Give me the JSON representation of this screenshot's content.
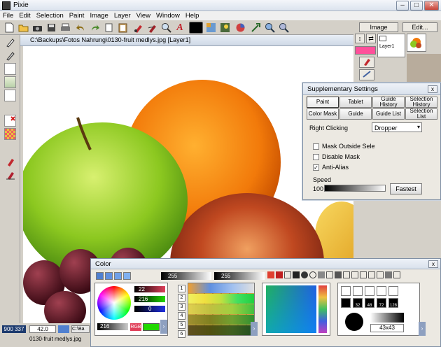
{
  "window": {
    "title": "Pixie",
    "minimize_glyph": "–",
    "maximize_glyph": "□",
    "close_glyph": "✕"
  },
  "menu": [
    "File",
    "Edit",
    "Selection",
    "Paint",
    "Image",
    "Layer",
    "View",
    "Window",
    "Help"
  ],
  "toolbar": {
    "icons": [
      "new-icon",
      "open-folder-icon",
      "camera-icon",
      "save-icon",
      "print-icon",
      "undo-icon",
      "redo-icon",
      "cut-icon",
      "paste-icon",
      "brush-icon",
      "smudge-icon",
      "zoom-icon",
      "text-icon",
      "color-swatch-icon",
      "pattern-icon",
      "effects-icon",
      "select-icon",
      "zoom-in-icon",
      "zoom-out-icon"
    ],
    "text_glyph": "A"
  },
  "document": {
    "title": "C:\\Backups\\Fotos Nahrung\\0130-fruit medlys.jpg [Layer1]"
  },
  "layers": {
    "image_button": "Image",
    "edit_button": "Edit...",
    "layer_name": "Layer1"
  },
  "supplementary": {
    "title": "Supplementary Settings",
    "tabs_row1": [
      "Paint",
      "Tablet",
      "Guide History",
      "Selection History"
    ],
    "tabs_row2": [
      "Color Mask",
      "Guide",
      "Guide List",
      "Selection List"
    ],
    "right_clicking_label": "Right Clicking",
    "right_clicking_value": "Dropper",
    "checkboxes": [
      {
        "label": "Mask Outside Sele",
        "checked": false
      },
      {
        "label": "Disable Mask",
        "checked": false
      },
      {
        "label": "Anti-Alias",
        "checked": true
      }
    ],
    "speed_label": "Speed",
    "speed_value": "100",
    "fastest_button": "Fastest",
    "close_glyph": "x"
  },
  "color": {
    "title": "Color",
    "top_value_1": "255",
    "top_value_2": "255",
    "rgb_values": [
      "22",
      "216",
      "0"
    ],
    "alpha_value": "216",
    "rgb_label": "RGB",
    "palette_tabs": [
      "1",
      "2",
      "3",
      "4",
      "5",
      "6"
    ],
    "brush_sizes": [
      "32",
      "48",
      "72",
      "128"
    ],
    "brush_dimension": "43x43",
    "close_glyph": "x"
  },
  "status": {
    "coords": "900 337",
    "zoom": "42.0",
    "filename": "0130-fruit medlys.jpg",
    "tab_label": "C:\\Ba"
  },
  "colors": {
    "accent_red": "#e0405a",
    "accent_green": "#22d800",
    "pink_swatch": "#ff4f9a"
  }
}
